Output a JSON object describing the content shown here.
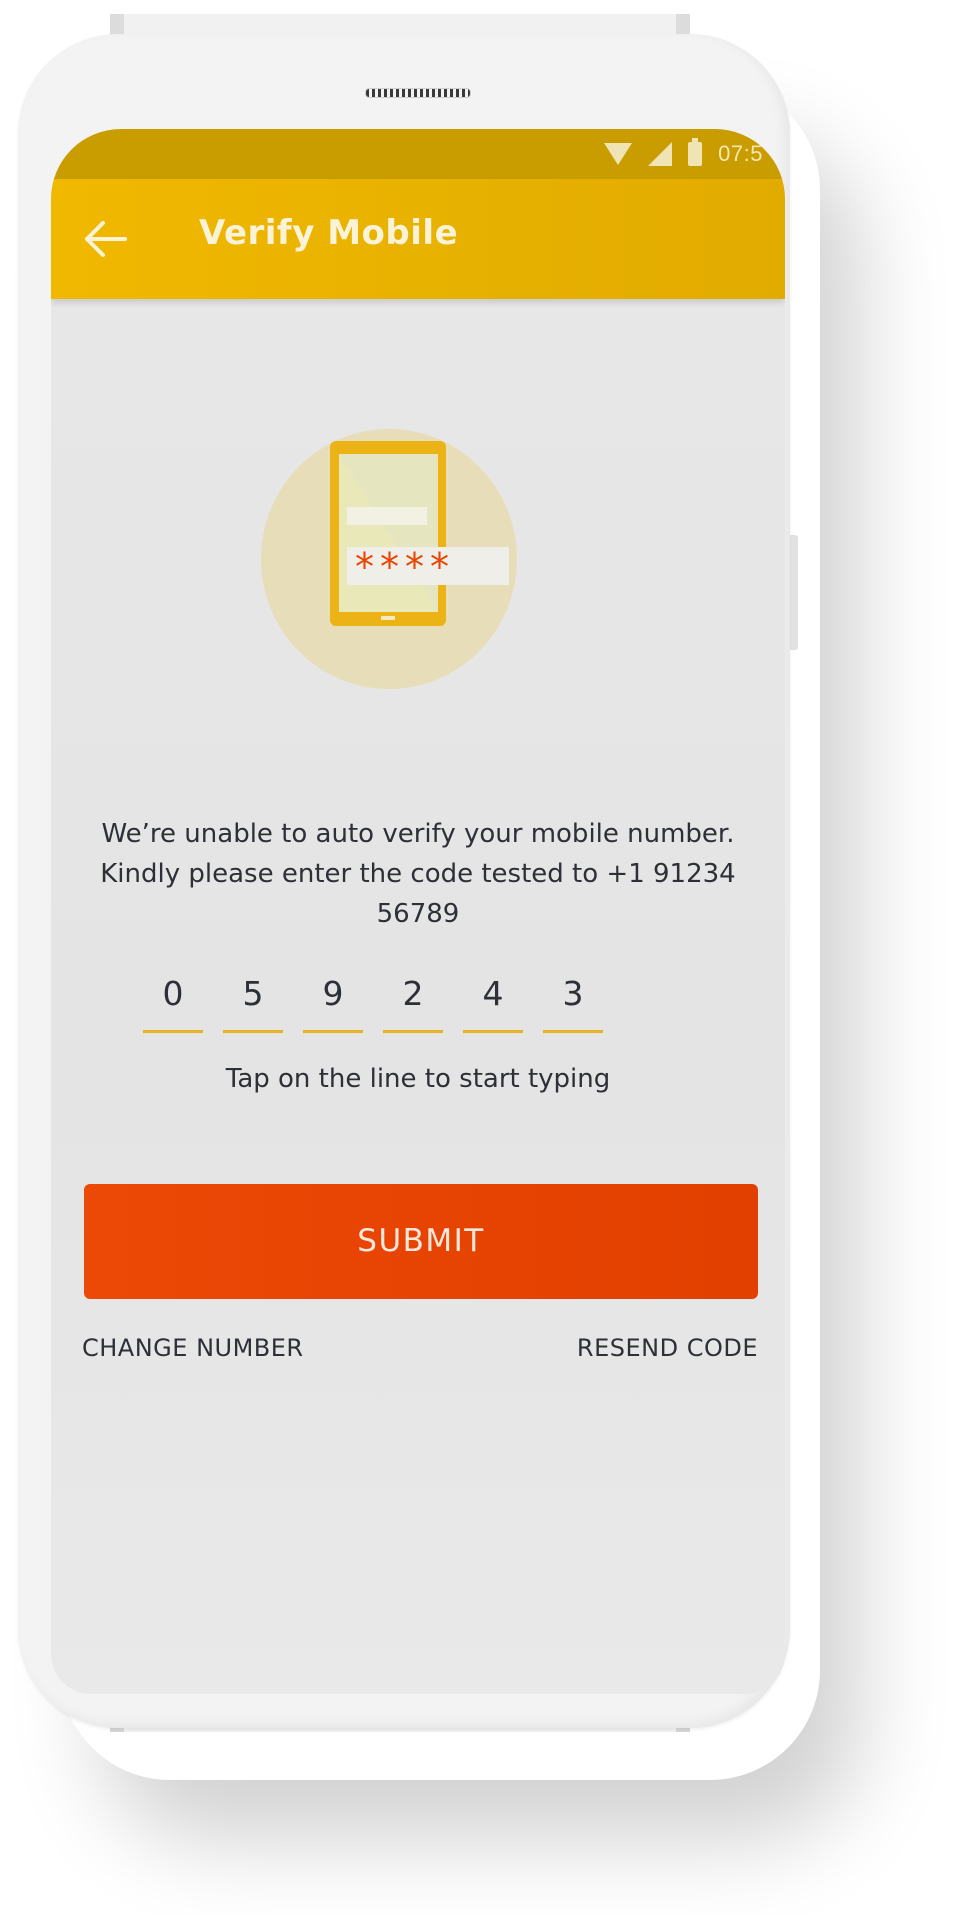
{
  "status_bar": {
    "time": "07:5",
    "icons": [
      "wifi-icon",
      "signal-icon",
      "battery-icon"
    ]
  },
  "app_bar": {
    "title": "Verify Mobile",
    "back_icon": "arrow-left-icon"
  },
  "illustration": {
    "icon": "phone-verification-icon",
    "masked_code": "****"
  },
  "message": {
    "text": "We’re unable to auto verify your mobile number. Kindly please enter the code tested to +1 91234 56789"
  },
  "code_input": {
    "digits": [
      "0",
      "5",
      "9",
      "2",
      "4",
      "3"
    ],
    "hint": "Tap on the line to start typing"
  },
  "actions": {
    "submit_label": "SUBMIT",
    "change_number_label": "CHANGE NUMBER",
    "resend_code_label": "RESEND CODE"
  },
  "colors": {
    "status_bar": "#c99c00",
    "app_bar": "#e8b200",
    "accent_orange": "#e84502",
    "code_underline": "#e7b223",
    "text": "#2d3037"
  }
}
